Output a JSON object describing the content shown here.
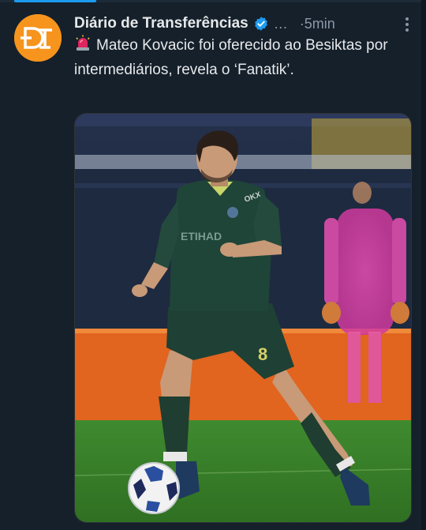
{
  "tweet": {
    "author": {
      "display_name": "Diário de Transferências",
      "verified": true,
      "avatar_text": "DT",
      "avatar_color": "#f7941d"
    },
    "timestamp": "5min",
    "truncation": "…",
    "dot_separator": "·",
    "text": "Mateo Kovacic foi oferecido ao Besiktas por intermediários, revela o ‘Fanatik’.",
    "emoji_icon": "siren-icon",
    "media": {
      "jersey_number": "8",
      "sponsor_text": "ETIHAD",
      "sleeve_text": "OKX"
    }
  },
  "colors": {
    "background": "#15202b",
    "accent": "#1d9bf0",
    "text_primary": "#e7e9ea",
    "text_secondary": "#8b98a5"
  }
}
